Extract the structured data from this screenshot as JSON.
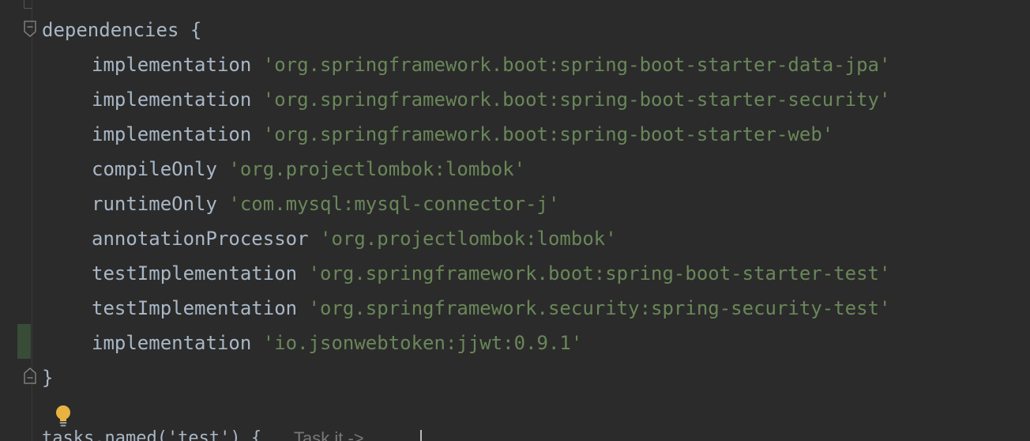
{
  "editor": {
    "lines": [
      {
        "keyword": "dependencies",
        "text": " {"
      },
      {
        "keyword": "implementation",
        "string": "'org.springframework.boot:spring-boot-starter-data-jpa'"
      },
      {
        "keyword": "implementation",
        "string": "'org.springframework.boot:spring-boot-starter-security'"
      },
      {
        "keyword": "implementation",
        "string": "'org.springframework.boot:spring-boot-starter-web'"
      },
      {
        "keyword": "compileOnly",
        "string": "'org.projectlombok:lombok'"
      },
      {
        "keyword": "runtimeOnly",
        "string": "'com.mysql:mysql-connector-j'"
      },
      {
        "keyword": "annotationProcessor",
        "string": "'org.projectlombok:lombok'"
      },
      {
        "keyword": "testImplementation",
        "string": "'org.springframework.boot:spring-boot-starter-test'"
      },
      {
        "keyword": "testImplementation",
        "string": "'org.springframework.security:spring-security-test'"
      },
      {
        "keyword": "implementation",
        "string": "'io.jsonwebtoken:jjwt:0.9.1'"
      },
      {
        "keyword": "",
        "text": "}"
      }
    ],
    "bottom_partial": "tasks.named('test') {",
    "bottom_hint": "Task it ->",
    "icons": {
      "fold_open": "fold-open-icon",
      "fold_close": "fold-close-icon",
      "intention": "lightbulb-icon"
    },
    "colors": {
      "background": "#2b2b2b",
      "text": "#a9b7c6",
      "string": "#6a8759",
      "bulb": "#e8b340",
      "change_marker": "#384c38"
    }
  }
}
